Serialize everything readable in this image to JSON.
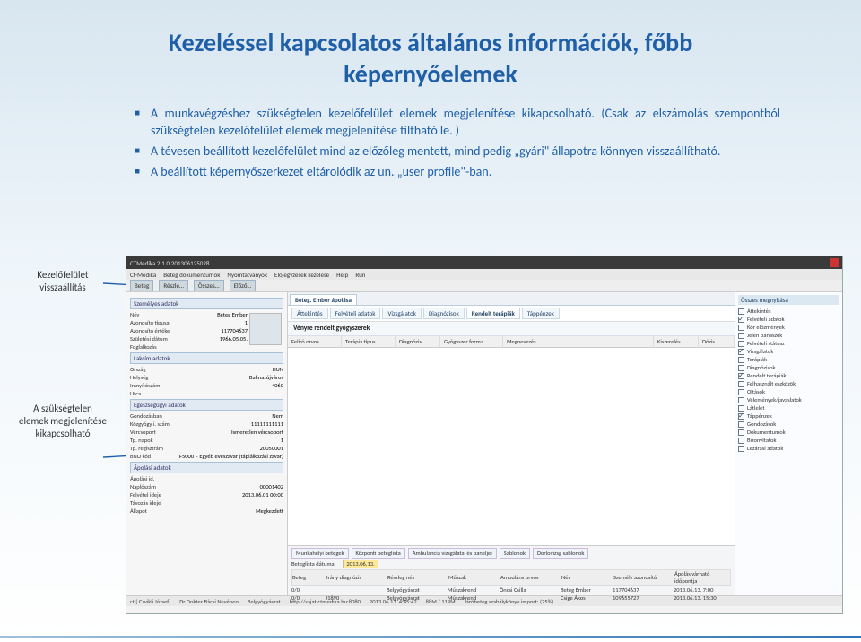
{
  "title": "Kezeléssel kapcsolatos általános információk, főbb képernyőelemek",
  "bullets": [
    "A munkavégzéshez szükségtelen kezelőfelület elemek megjelenítése kikapcsolható. (Csak az elszámolás szempontból szükségtelen kezelőfelület elemek megjelenítése tiltható le. )",
    "A tévesen beállított kezelőfelület mind az előzőleg mentett, mind pedig „gyári\" állapotra könnyen visszaállítható.",
    "A beállított képernyőszerkezet eltárolódik az un. „user profile\"-ban."
  ],
  "side_labels": {
    "a": "Kezelőfelület visszaállítás",
    "b": "A szükségtelen elemek megjelenítése kikapcsolható"
  },
  "app": {
    "window_title": "CTMedika 2.1.0.201306125028",
    "menus": [
      "Ct-Medika",
      "Beteg dokumentumok",
      "Nyomtatványok",
      "Előjegyzések kezelése",
      "Help",
      "Run"
    ],
    "toolbar": [
      "Beteg",
      "Részle…",
      "Összes…",
      "Előző…"
    ],
    "tabs": [
      "Beteg. Ember ápolása"
    ],
    "subtabs": [
      "Áttekintés",
      "Felvételi adatok",
      "Vizsgálatok",
      "Diagnózisok",
      "Rendelt terápiák",
      "Táppénzek"
    ],
    "panel_title": "Vényre rendelt gyógyszerek",
    "grid_cols": [
      "Felíró orvos",
      "Terápia típus",
      "Diagnózis",
      "Gyógyszer forma",
      "Megnevezés",
      "Kiszerelés",
      "Dózis"
    ],
    "right_header": "Összes megnyitása",
    "right_items": [
      {
        "label": "Áttekintés",
        "checked": false
      },
      {
        "label": "Felvételi adatok",
        "checked": true
      },
      {
        "label": "Kór előzmények",
        "checked": false
      },
      {
        "label": "Jelen panaszok",
        "checked": false
      },
      {
        "label": "Felvételi státusz",
        "checked": false
      },
      {
        "label": "Vizsgálatok",
        "checked": true
      },
      {
        "label": "Terápiák",
        "checked": false
      },
      {
        "label": "Diagnózisok",
        "checked": false
      },
      {
        "label": "Rendelt terápiák",
        "checked": true
      },
      {
        "label": "Felhasznált eszközök",
        "checked": false
      },
      {
        "label": "Oltások",
        "checked": false
      },
      {
        "label": "Vélemények/javaslatok",
        "checked": false
      },
      {
        "label": "Látlelet",
        "checked": false
      },
      {
        "label": "Táppénzek",
        "checked": true
      },
      {
        "label": "Gondozások",
        "checked": false
      },
      {
        "label": "Dokumentumok",
        "checked": false
      },
      {
        "label": "BizonyItatok",
        "checked": false
      },
      {
        "label": "Lezárási adatok",
        "checked": false
      }
    ],
    "patient": {
      "section1": "Személyes adatok",
      "name_k": "Név",
      "name_v": "Beteg Ember",
      "idtype_k": "Azonosító típusa",
      "idtype_v": "1",
      "idval_k": "Azonosító értéke",
      "idval_v": "117704637",
      "bdate_k": "Születési dátum",
      "bdate_v": "1966.05.05.",
      "occ_k": "Foglalkozás",
      "occ_v": "",
      "section2": "Lakcím adatok",
      "ctry_k": "Ország",
      "ctry_v": "HUN",
      "city_k": "Helység",
      "city_v": "Balmazújváros",
      "zip_k": "Irányítószám",
      "zip_v": "4060",
      "street_k": "Utca",
      "street_v": "",
      "section3": "Egészségügyi adatok",
      "gond_k": "Gondozásban",
      "gond_v": "Nem",
      "kozgy_k": "Közgyógy i. szám",
      "kozgy_v": "11111111111",
      "vcs_k": "Vércsoport",
      "vcs_v": "Ismeretlen vércsoport",
      "tpn_k": "Tp. napok",
      "tpn_v": "1",
      "tpr_k": "Tp. regisztrám",
      "tpr_v": "20050001",
      "bno_k": "BNO kód",
      "bno_v": "F5000 – Egyéb evészavar (táplálkozási zavar)",
      "section4": "Ápolási adatok",
      "apid_k": "Ápolási id.",
      "apid_v": "",
      "nsz_k": "Naplószám",
      "nsz_v": "00001402",
      "fid_k": "Felvétel ideje",
      "fid_v": "2013.06.01 00:00",
      "tav_k": "Távozás ideje",
      "tav_v": "",
      "all_k": "Állapot",
      "all_v": "Megkezdett"
    },
    "bottom": {
      "tabs": [
        "Munkahelyi betegek",
        "Központi beteglista",
        "Ambulancia vizsgálatai és paneljei",
        "Sablonok",
        "Dorlovizsg sablonok"
      ],
      "date_label": "Beteglista dátuma:",
      "date_val": "2013.06.13.",
      "cols": [
        "Beteg",
        "Irány diagnózis",
        "Részleg név",
        "Műszak",
        "Ambuláns orvos",
        "Név",
        "Személy azonosító",
        "Ápolás várható időpontja"
      ],
      "rows": [
        [
          "0/0",
          "",
          "Belgyógyászat",
          "Műszakrend",
          "Öncsi Csilla",
          "Beteg Ember",
          "117704637",
          "2013.06.13. 7:00"
        ],
        [
          "0/0",
          "J1890",
          "Belgyógyászat",
          "Műszakrend",
          "",
          "Csige Ákos",
          "109655727",
          "2013.06.13. 15:30"
        ]
      ],
      "status": [
        "ct [ Czvikli József]",
        "Dr Dokter Bácsi Nevében",
        "Belgyógyászat",
        "http://sajat.ctmedika.hu:8080",
        "2013.06.13. 4:45:42",
        "88M / 119M",
        "Járóbeteg szabálykönyv import: (75%)"
      ]
    }
  }
}
